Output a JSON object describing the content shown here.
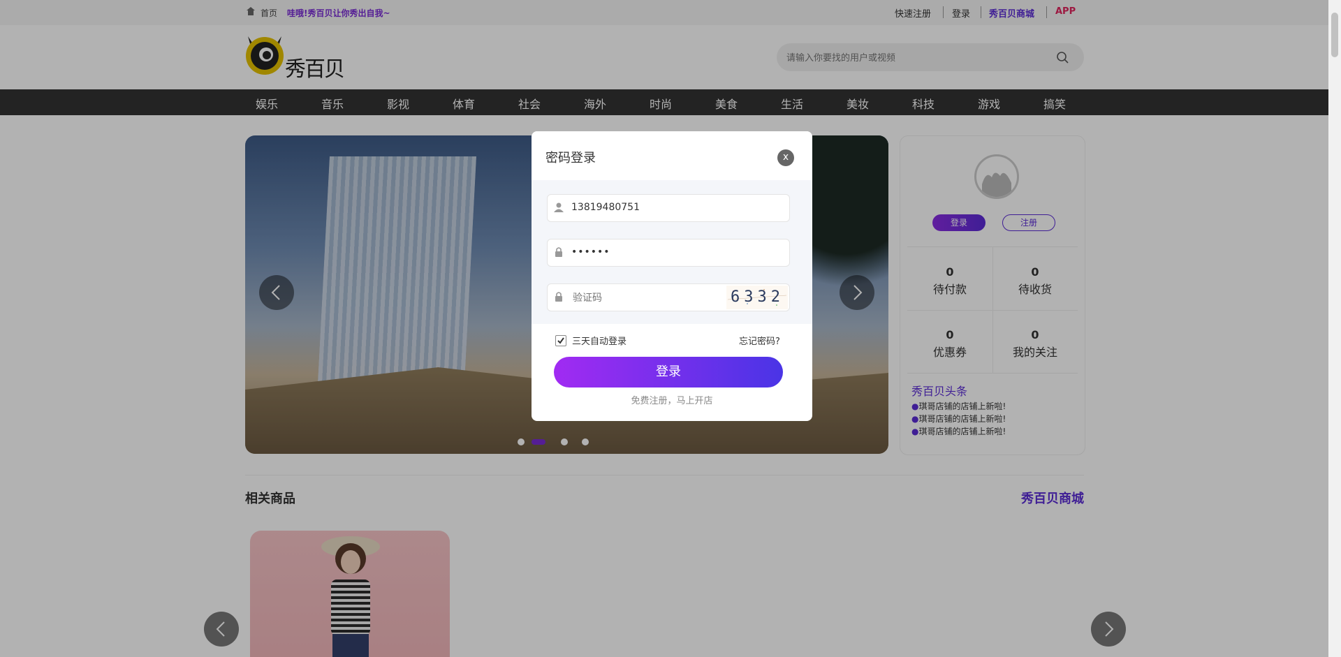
{
  "topbar": {
    "home": "首页",
    "slogan": "哇哦!秀百贝让你秀出自我~",
    "links": [
      "快速注册",
      "登录",
      "秀百贝商城",
      "APP"
    ],
    "colors": {
      "accent": "#7a2bd6",
      "app": "#e0245e"
    }
  },
  "header": {
    "logo_text": "秀百贝",
    "search_placeholder": "请输入你要找的用户或视频"
  },
  "nav": {
    "items": [
      "娱乐",
      "音乐",
      "影视",
      "体育",
      "社会",
      "海外",
      "时尚",
      "美食",
      "生活",
      "美妆",
      "科技",
      "游戏",
      "搞笑"
    ]
  },
  "banner": {
    "active_dot": 1,
    "dot_count": 4
  },
  "panel": {
    "login_btn": "登录",
    "register_btn": "注册",
    "stats": [
      {
        "num": "0",
        "label": "待付款"
      },
      {
        "num": "0",
        "label": "待收货"
      },
      {
        "num": "0",
        "label": "优惠券"
      },
      {
        "num": "0",
        "label": "我的关注"
      }
    ],
    "news_title": "秀百贝头条",
    "news": [
      "琪哥店铺的店铺上新啦!",
      "琪哥店铺的店铺上新啦!",
      "琪哥店铺的店铺上新啦!"
    ]
  },
  "section": {
    "title": "相关商品",
    "link": "秀百贝商城"
  },
  "modal": {
    "title": "密码登录",
    "close": "x",
    "phone": "13819480751",
    "password_mask": "••••••",
    "captcha_placeholder": "验证码",
    "captcha_text": "6332",
    "remember_label": "三天自动登录",
    "remember_checked": true,
    "forgot": "忘记密码?",
    "submit": "登录",
    "footer": "免费注册，马上开店"
  }
}
